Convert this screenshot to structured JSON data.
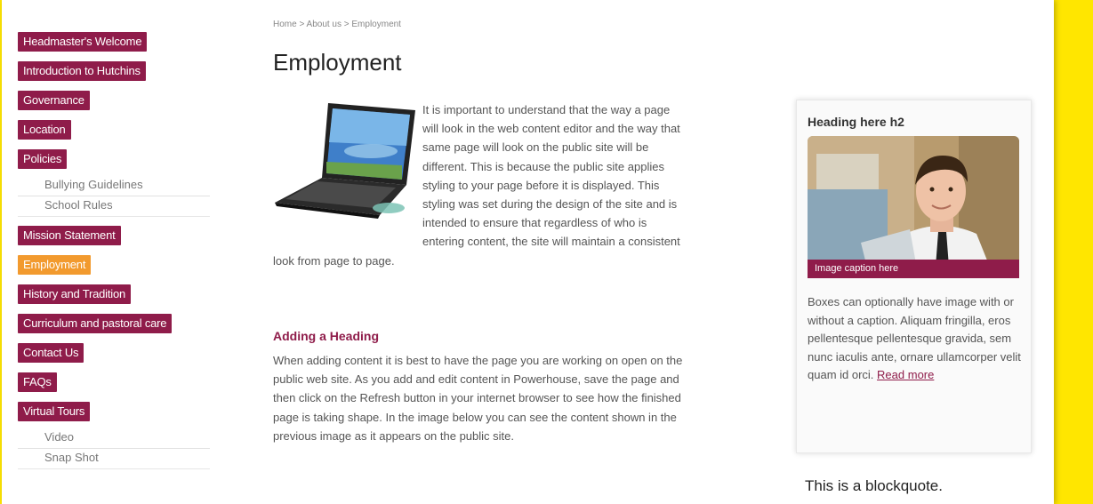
{
  "breadcrumb": "Home > About us > Employment",
  "page_title": "Employment",
  "nav": {
    "items": [
      {
        "label": "Headmaster's Welcome",
        "active": false
      },
      {
        "label": "Introduction to Hutchins",
        "active": false
      },
      {
        "label": "Governance",
        "active": false
      },
      {
        "label": "Location",
        "active": false
      },
      {
        "label": "Policies",
        "active": false
      }
    ],
    "policies_sub": [
      "Bullying Guidelines",
      "School Rules"
    ],
    "items2": [
      {
        "label": "Mission Statement",
        "active": false
      },
      {
        "label": "Employment",
        "active": true
      },
      {
        "label": "History and Tradition",
        "active": false
      },
      {
        "label": "Curriculum and pastoral care",
        "active": false
      },
      {
        "label": "Contact Us",
        "active": false
      },
      {
        "label": "FAQs",
        "active": false
      },
      {
        "label": "Virtual Tours",
        "active": false
      }
    ],
    "tours_sub": [
      "Video",
      "Snap Shot"
    ]
  },
  "content": {
    "para1": "It is important to understand that the way a page will look in the web content editor and the way that same page will look on the public site will be different. This is because the public site applies styling to your page before it is displayed. This styling was set during the design of the site and is intended to ensure that regardless of who is entering content, the site will maintain a consistent look from page to page.",
    "heading": "Adding a Heading",
    "para2": "When adding content it is best to have the page you are working on open on the public web site. As you add and edit content in Powerhouse, save the page and then click on the Refresh button in your internet browser to see how the finished page is taking shape. In the image below you can see the content shown in the previous image as it appears on the public site."
  },
  "sidebox": {
    "heading": "Heading here h2",
    "caption": "Image caption here",
    "text": "Boxes can optionally have image with or without a caption. Aliquam fringilla, eros pellentesque pellentesque gravida, sem nunc iaculis ante, ornare ullamcorper velit quam id orci.",
    "read_more": "Read more"
  },
  "blockquote": "This is a blockquote.",
  "colors": {
    "brand": "#8f1c4a",
    "active": "#f29a2e",
    "background_accent": "#ffe600"
  }
}
